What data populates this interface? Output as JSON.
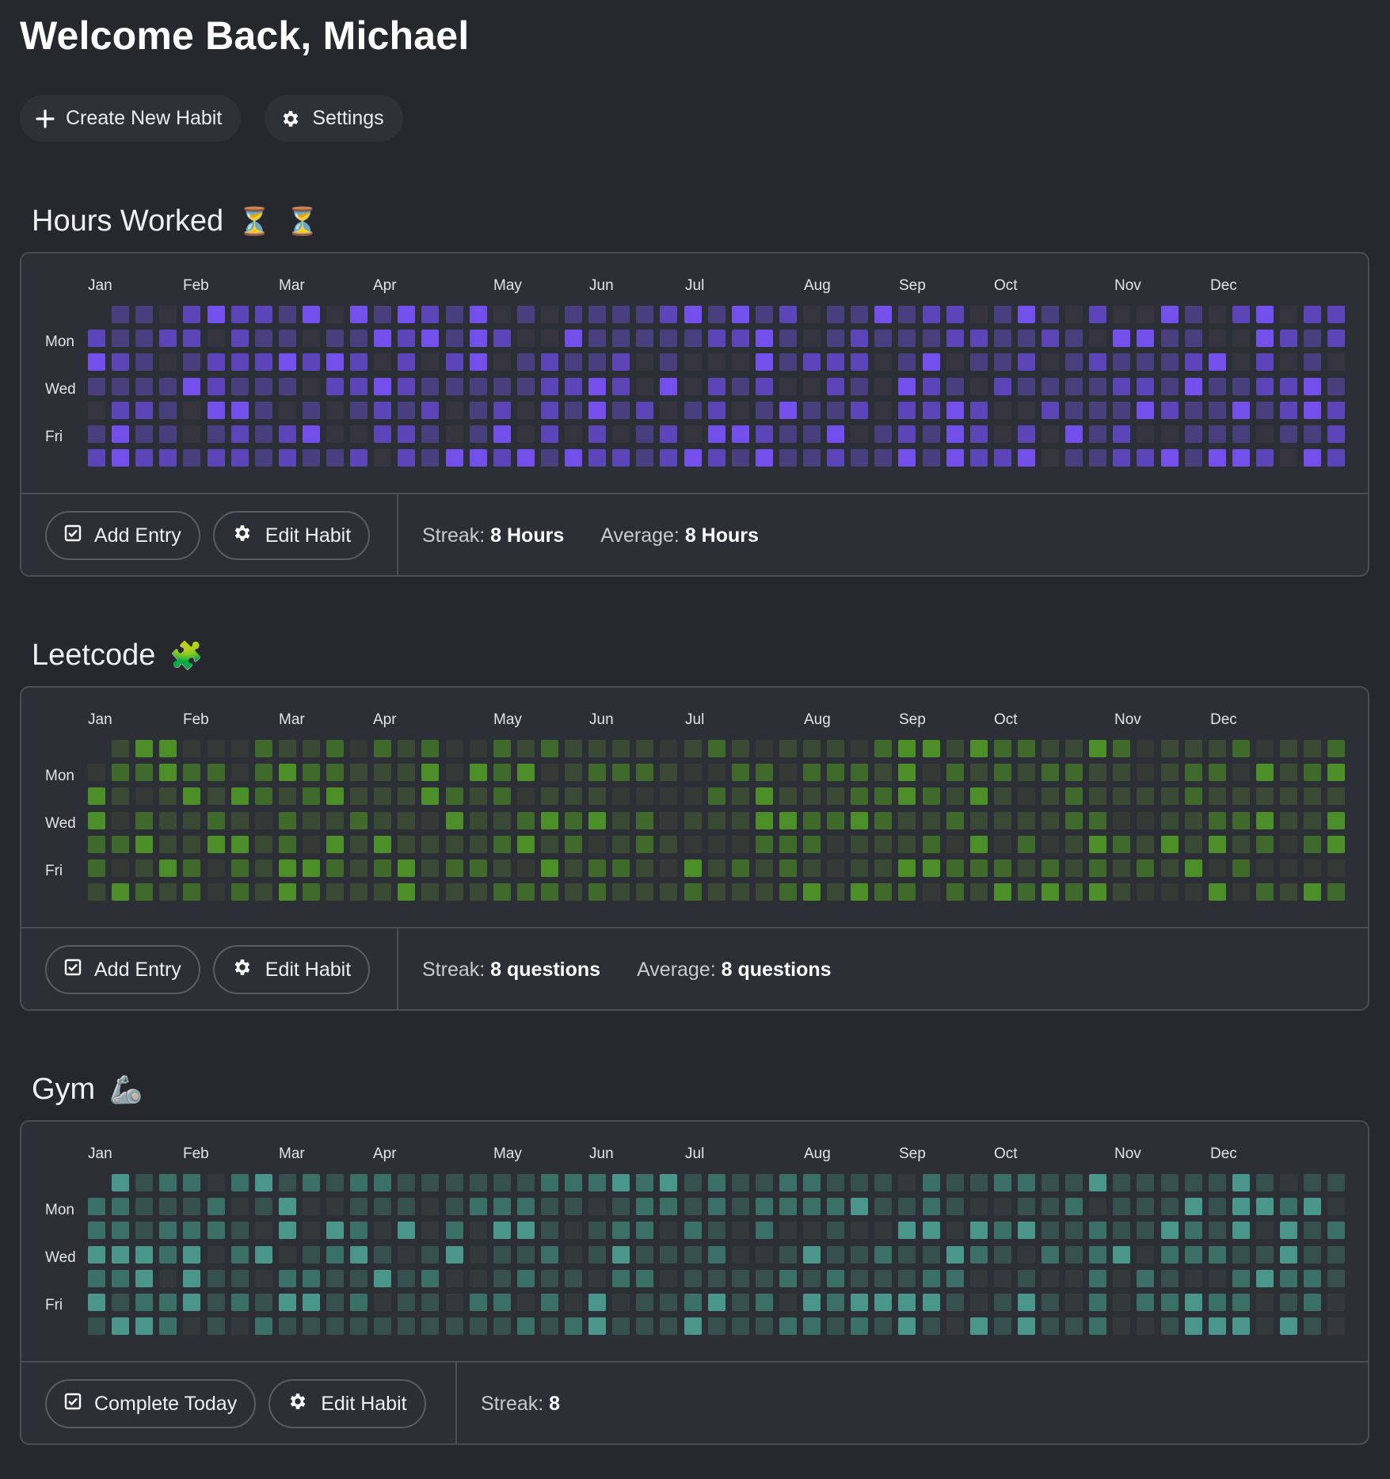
{
  "header": {
    "title": "Welcome Back, Michael",
    "create_label": "Create New Habit",
    "settings_label": "Settings"
  },
  "months": [
    "Jan",
    "Feb",
    "Mar",
    "Apr",
    "May",
    "Jun",
    "Jul",
    "Aug",
    "Sep",
    "Oct",
    "Nov",
    "Dec"
  ],
  "days": [
    "Mon",
    "Wed",
    "Fri"
  ],
  "habits": [
    {
      "title": "Hours Worked",
      "emoji": [
        "⏳",
        "⏳"
      ],
      "primary_label": "Add Entry",
      "edit_label": "Edit Habit",
      "streak_label": "Streak:",
      "streak_value": "8 Hours",
      "average_label": "Average:",
      "average_value": "8 Hours",
      "palette": [
        "#36343e",
        "#4a3f7e",
        "#5b45b8",
        "#7350ec"
      ],
      "seed": 11
    },
    {
      "title": "Leetcode",
      "emoji": [
        "🧩"
      ],
      "primary_label": "Add Entry",
      "edit_label": "Edit Habit",
      "streak_label": "Streak:",
      "streak_value": "8 questions",
      "average_label": "Average:",
      "average_value": "8 questions",
      "palette": [
        "#363a37",
        "#3b4a35",
        "#3f6a2c",
        "#4c8f28"
      ],
      "seed": 23
    },
    {
      "title": "Gym",
      "emoji": [
        "🦾"
      ],
      "primary_label": "Complete Today",
      "edit_label": "Edit Habit",
      "streak_label": "Streak:",
      "streak_value": "8",
      "average_label": "",
      "average_value": "",
      "palette": [
        "#343a3c",
        "#35504f",
        "#3b7068",
        "#4b968a"
      ],
      "seed": 37
    }
  ]
}
